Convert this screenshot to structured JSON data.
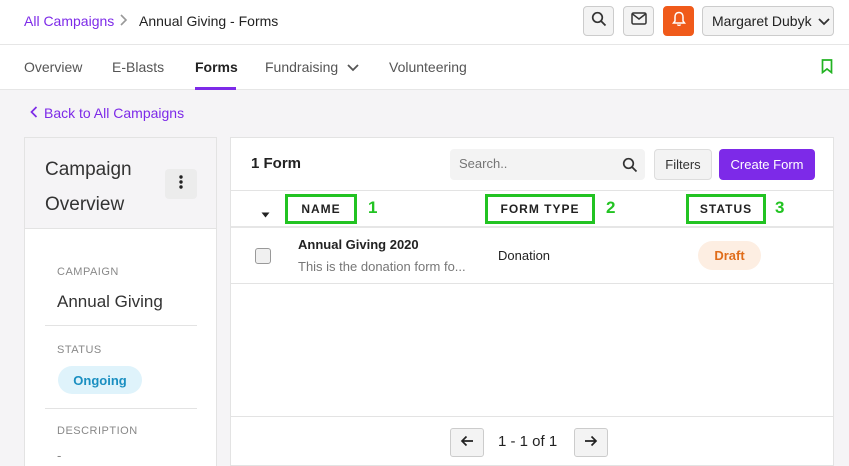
{
  "breadcrumb": {
    "parent": "All Campaigns",
    "separator": ">",
    "current": "Annual Giving - Forms"
  },
  "header": {
    "icons": [
      "search-icon",
      "mail-icon",
      "bell-icon"
    ],
    "user_name": "Margaret Dubyk",
    "accent_color": "#7d2ae8",
    "bell_color": "#f05a1a"
  },
  "tabs": [
    {
      "label": "Overview"
    },
    {
      "label": "E-Blasts"
    },
    {
      "label": "Forms",
      "active": true
    },
    {
      "label": "Fundraising"
    },
    {
      "label": "Volunteering"
    }
  ],
  "back_link": "Back to All Campaigns",
  "overview": {
    "title": "Campaign Overview",
    "campaign_label": "CAMPAIGN",
    "campaign_value": "Annual Giving",
    "status_label": "STATUS",
    "status_value": "Ongoing",
    "description_label": "DESCRIPTION",
    "description_value": "-"
  },
  "forms": {
    "count_label": "1 Form",
    "search_placeholder": "Search..",
    "filters_label": "Filters",
    "create_label": "Create Form",
    "columns": [
      {
        "label": "NAME",
        "marker": "1"
      },
      {
        "label": "FORM TYPE",
        "marker": "2"
      },
      {
        "label": "STATUS",
        "marker": "3"
      }
    ],
    "rows": [
      {
        "name": "Annual Giving 2020",
        "description": "This is the donation form fo...",
        "type": "Donation",
        "status": "Draft"
      }
    ],
    "pagination": "1 - 1 of 1"
  }
}
